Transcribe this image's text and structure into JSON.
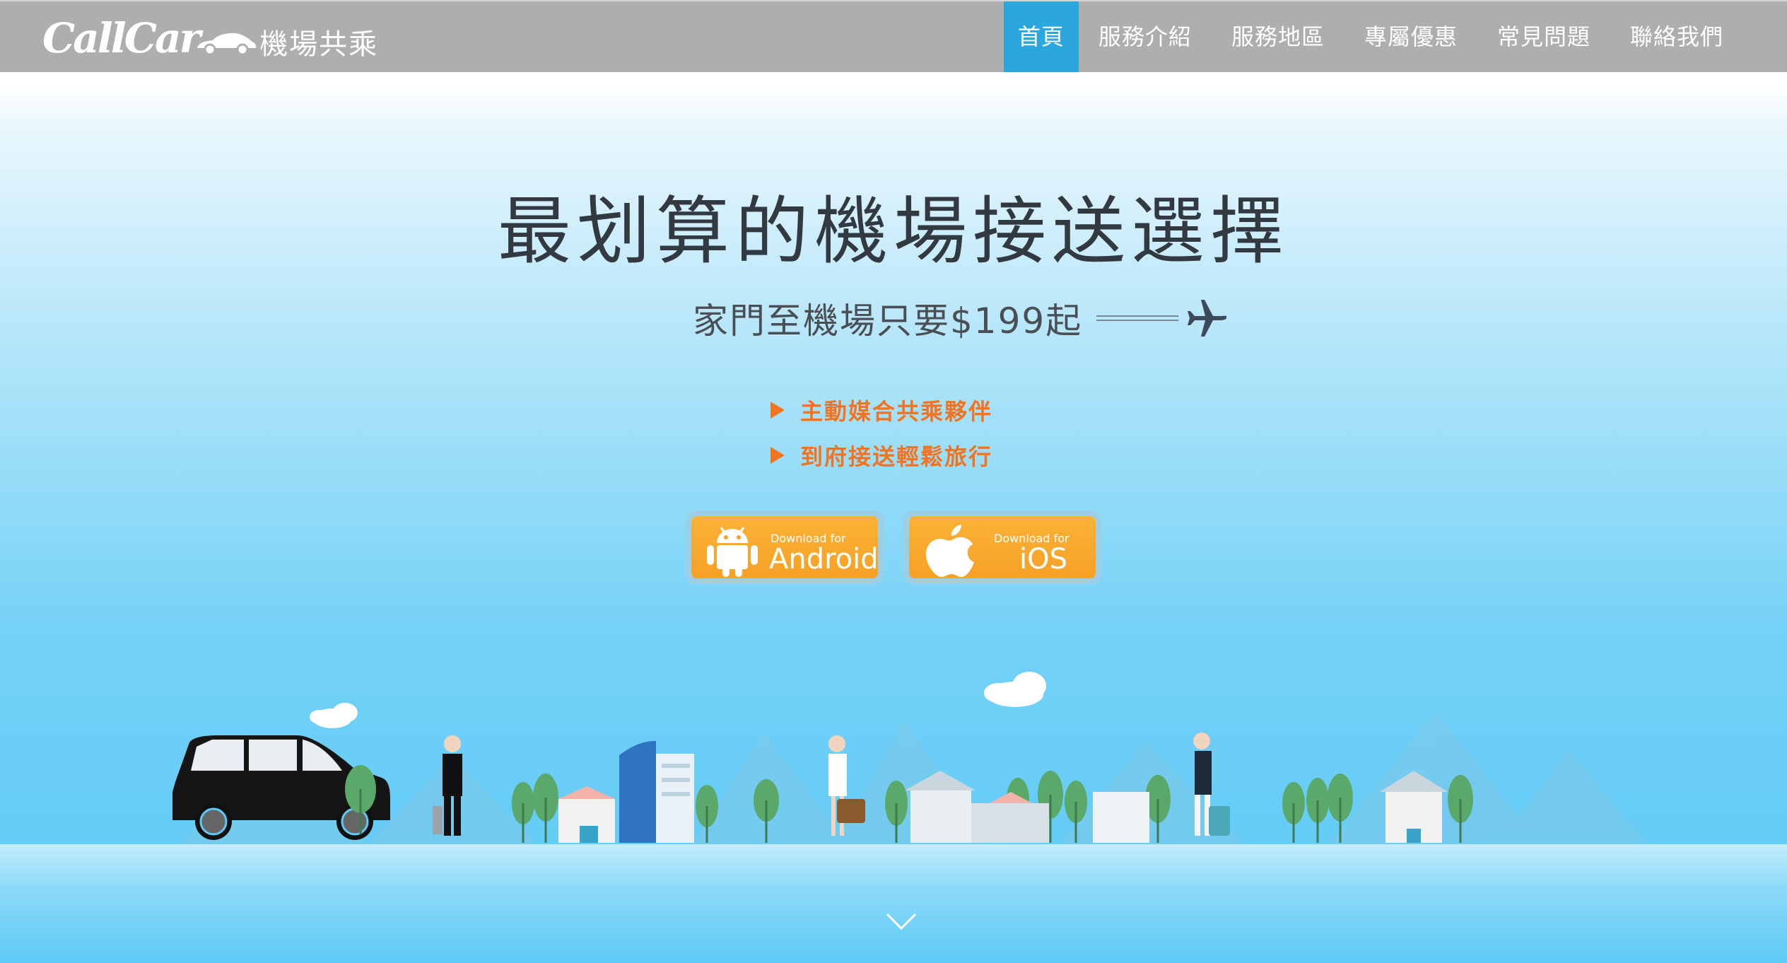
{
  "brand": {
    "logo_wordmark": "CallCar",
    "logo_cn": "機場共乘"
  },
  "nav": {
    "items": [
      {
        "label": "首頁",
        "active": true
      },
      {
        "label": "服務介紹",
        "active": false
      },
      {
        "label": "服務地區",
        "active": false
      },
      {
        "label": "專屬優惠",
        "active": false
      },
      {
        "label": "常見問題",
        "active": false
      },
      {
        "label": "聯絡我們",
        "active": false
      }
    ]
  },
  "hero": {
    "headline": "最划算的機場接送選擇",
    "subline": "家門至機場只要$199起",
    "bullets": [
      "主動媒合共乘夥伴",
      "到府接送輕鬆旅行"
    ]
  },
  "downloads": {
    "android": {
      "small": "Download for",
      "big": "Android"
    },
    "ios": {
      "small": "Download for",
      "big": "iOS"
    }
  },
  "colors": {
    "nav_bg": "#aeaeae",
    "nav_active": "#2ba7dd",
    "accent_orange": "#f27320",
    "button_orange": "#f6a126",
    "sky_blue": "#5cc9f6"
  },
  "icons": [
    "airplane-icon",
    "android-robot-icon",
    "apple-icon",
    "chevron-down-icon",
    "car-silhouette-icon"
  ]
}
